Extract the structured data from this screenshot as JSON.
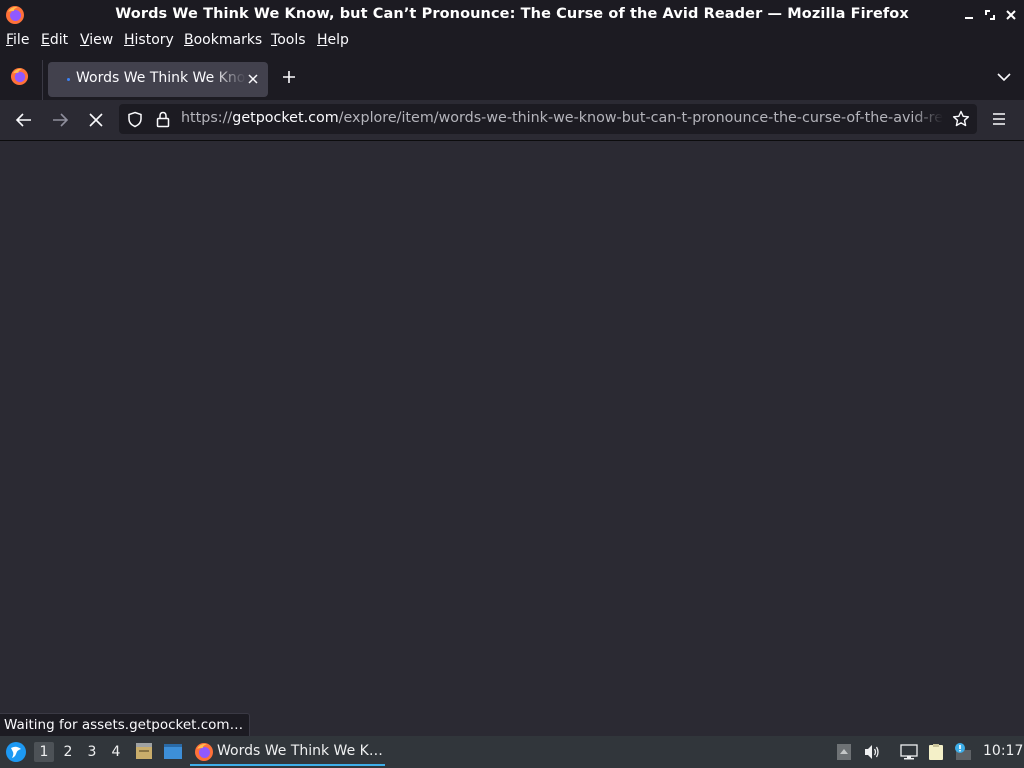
{
  "window": {
    "title": "Words We Think We Know, but Can’t Pronounce: The Curse of the Avid Reader — Mozilla Firefox",
    "controls": [
      "minimize-icon",
      "maximize-icon",
      "close-icon"
    ]
  },
  "menubar": {
    "items": [
      {
        "label": "File",
        "accel": "F",
        "rest": "ile"
      },
      {
        "label": "Edit",
        "accel": "E",
        "rest": "dit"
      },
      {
        "label": "View",
        "accel": "V",
        "rest": "iew"
      },
      {
        "label": "History",
        "accel": "H",
        "rest": "istory"
      },
      {
        "label": "Bookmarks",
        "accel": "B",
        "rest": "ookmarks"
      },
      {
        "label": "Tools",
        "accel": "T",
        "rest": "ools"
      },
      {
        "label": "Help",
        "accel": "H",
        "rest": "elp"
      }
    ]
  },
  "tabs": [
    {
      "title": "Words We Think We Know, but Can’t Pronounce: The Curse of the Avid Reader",
      "loading": true,
      "active": true
    }
  ],
  "navbar": {
    "url_scheme": "https://",
    "url_host": "getpocket.com",
    "url_path": "/explore/item/words-we-think-we-know-but-can-t-pronounce-the-curse-of-the-avid-reader"
  },
  "status": {
    "text": "Waiting for assets.getpocket.com…"
  },
  "taskbar": {
    "workspaces": [
      "1",
      "2",
      "3",
      "4"
    ],
    "active_workspace": "1",
    "task_label": "Words We Think We K…",
    "clock": "10:17"
  },
  "colors": {
    "chrome": "#1c1b22",
    "content_bg": "#2b2a33",
    "active_tab": "#42414d",
    "taskbar": "#31363b",
    "accent": "#3daee9"
  }
}
